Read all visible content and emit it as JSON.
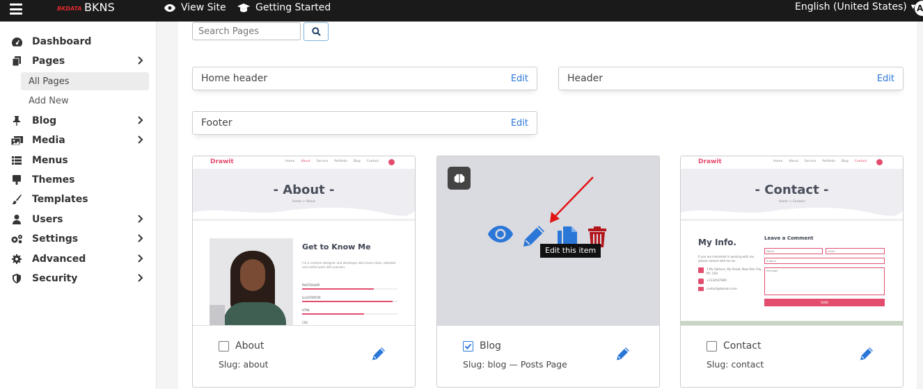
{
  "topbar": {
    "logo_text": "BKDATA",
    "brand": "BKNS",
    "view_site": "View Site",
    "getting_started": "Getting Started",
    "language": "English (United States)",
    "avatar_letter": "A"
  },
  "sidebar": {
    "items": [
      {
        "label": "Dashboard",
        "icon": "dashboard-icon"
      },
      {
        "label": "Pages",
        "icon": "pages-icon"
      },
      {
        "label": "Blog",
        "icon": "pin-icon"
      },
      {
        "label": "Media",
        "icon": "media-icon"
      },
      {
        "label": "Menus",
        "icon": "list-icon"
      },
      {
        "label": "Themes",
        "icon": "brush-icon"
      },
      {
        "label": "Templates",
        "icon": "paintbrush-icon"
      },
      {
        "label": "Users",
        "icon": "user-icon"
      },
      {
        "label": "Settings",
        "icon": "gears-icon"
      },
      {
        "label": "Advanced",
        "icon": "gear-icon"
      },
      {
        "label": "Security",
        "icon": "shield-icon"
      }
    ],
    "subitems": [
      {
        "label": "All Pages",
        "active": true
      },
      {
        "label": "Add New",
        "active": false
      }
    ]
  },
  "search": {
    "placeholder": "Search Pages"
  },
  "widgets": [
    {
      "label": "Home header",
      "edit": "Edit"
    },
    {
      "label": "Header",
      "edit": "Edit"
    },
    {
      "label": "Footer",
      "edit": "Edit"
    }
  ],
  "cards": [
    {
      "title": "About",
      "slug": "Slug: about",
      "checked": false,
      "thumb": {
        "brand": "Drawit",
        "links": [
          "Home",
          "About",
          "Service",
          "Portfolio",
          "Blog",
          "Contact"
        ],
        "hero": "- About -",
        "crumb": "Home > About",
        "heading": "Get to Know Me",
        "skills": [
          "PHOTOSHOP",
          "ILLUSTRATOR",
          "HTML",
          "CSS"
        ],
        "bio": "I'm a creative designer and developer who loves clean, detailed and useful work with passion."
      }
    },
    {
      "title": "Blog",
      "slug": "Slug: blog — Posts Page",
      "checked": true,
      "overlay": {
        "tooltip": "Edit this item"
      }
    },
    {
      "title": "Contact",
      "slug": "Slug: contact",
      "checked": false,
      "thumb": {
        "brand": "Drawit",
        "links": [
          "Home",
          "About",
          "Service",
          "Portfolio",
          "Blog",
          "Contact"
        ],
        "hero": "- Contact -",
        "crumb": "Home > Contact",
        "info_title": "My Info.",
        "info_text": "If you are interested in working with me, please contact with me ok.",
        "address": "1 My Address, My Street, New York City, NY, USA",
        "phone": "+1234567890",
        "email": "contact@domain.com",
        "form_title": "Leave a Comment",
        "fields": [
          "Name",
          "Email",
          "Subject",
          "Message"
        ],
        "send": "SEND"
      }
    }
  ],
  "colors": {
    "accent": "#2a77d8",
    "brand_pink": "#e24d6e",
    "topbar": "#1a1a1a",
    "delete_red": "#b3151b",
    "arrow_red": "#e11414"
  }
}
